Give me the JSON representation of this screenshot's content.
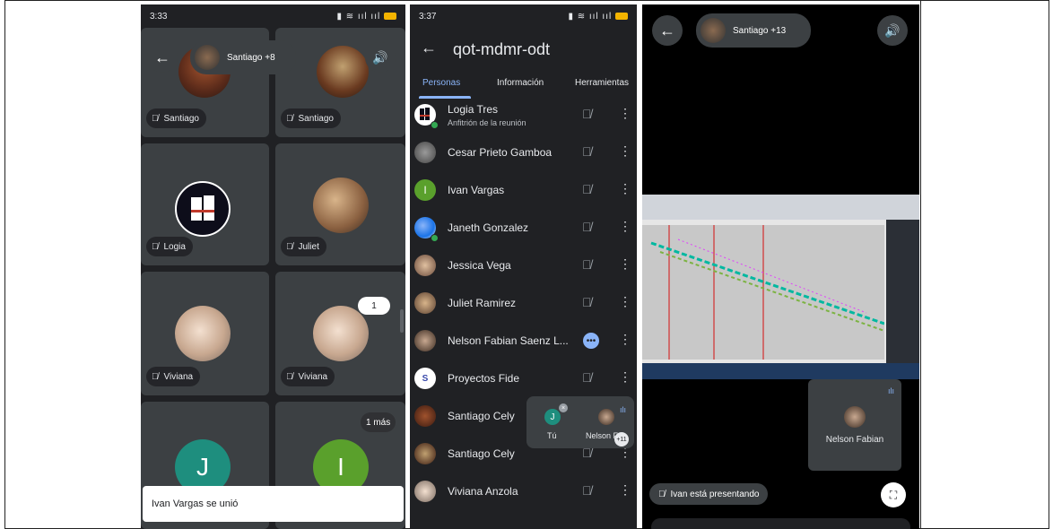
{
  "screen1": {
    "status_time": "3:33",
    "back_icon": "arrow-left-icon",
    "participants_pill": "Santiago +8",
    "tiles": [
      {
        "label": "Santiago"
      },
      {
        "label": "Santiago"
      },
      {
        "label": "Logia"
      },
      {
        "label": "Juliet"
      },
      {
        "label": "Viviana"
      },
      {
        "label": "Viviana"
      },
      {
        "initial": "J",
        "color": "#1e8e7e"
      },
      {
        "initial": "I",
        "color": "#5aa02c"
      }
    ],
    "pip_count": "1",
    "more_badge": "1 más",
    "toast": "Ivan Vargas se unió"
  },
  "screen2": {
    "status_time": "3:37",
    "title": "qot-mdmr-odt",
    "tabs": [
      "Personas",
      "Información",
      "Herramientas"
    ],
    "people": [
      {
        "name": "Logia Tres",
        "sub": "Anfitrión de la reunión"
      },
      {
        "name": "Cesar Prieto Gamboa"
      },
      {
        "name": "Ivan Vargas",
        "initial": "I"
      },
      {
        "name": "Janeth Gonzalez"
      },
      {
        "name": "Jessica Vega"
      },
      {
        "name": "Juliet Ramirez"
      },
      {
        "name": "Nelson Fabian Saenz L..."
      },
      {
        "name": "Proyectos Fide"
      },
      {
        "name": "Santiago Cely"
      },
      {
        "name": "Santiago Cely"
      },
      {
        "name": "Viviana Anzola"
      }
    ],
    "self_view": {
      "you": "Tú",
      "you_initial": "J",
      "other": "Nelson Fa",
      "count": "+11"
    }
  },
  "screen3": {
    "participants_pill": "Santiago +13",
    "tile_name": "Nelson Fabian",
    "presenting": "Ivan está presentando"
  }
}
